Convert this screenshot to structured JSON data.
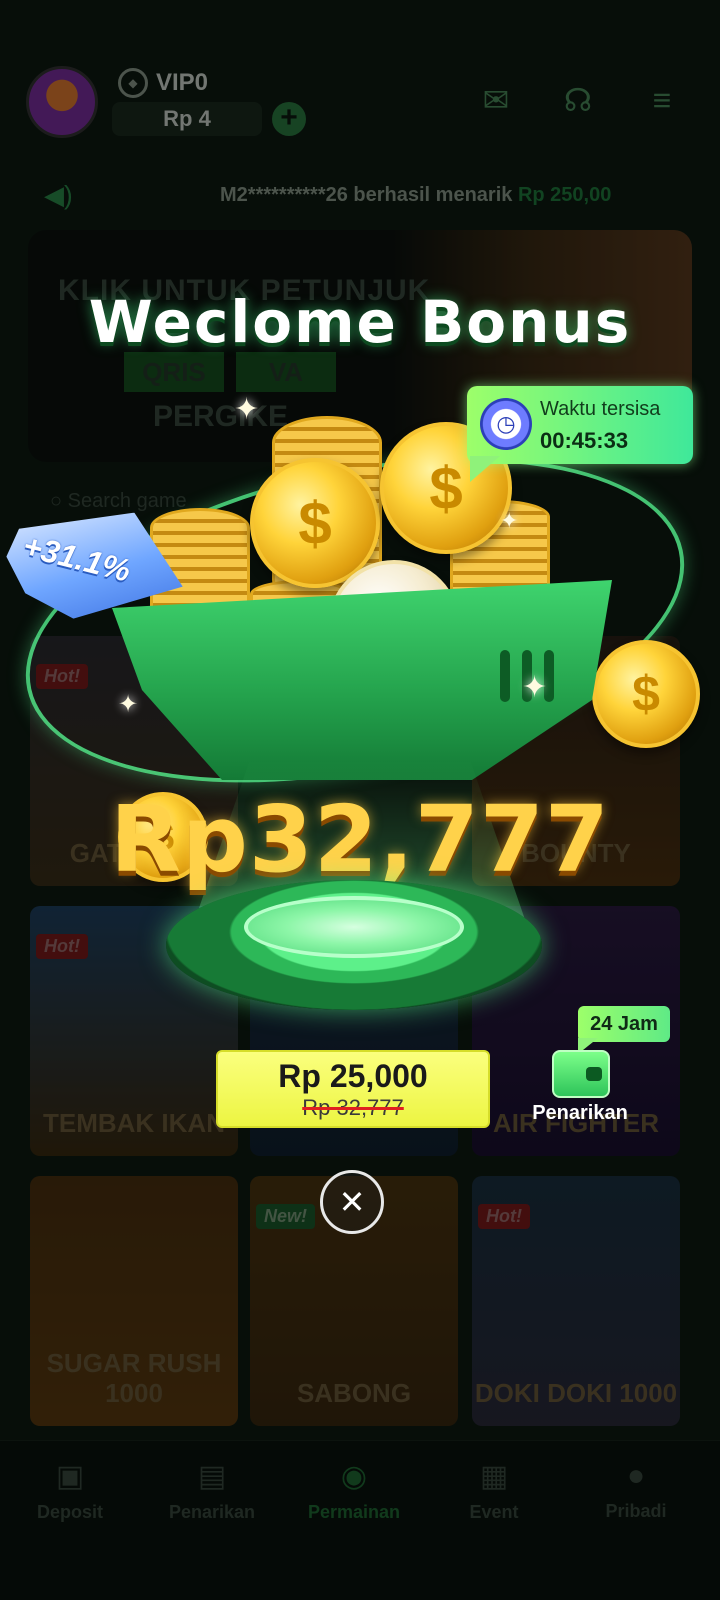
{
  "header": {
    "vip_label": "VIP0",
    "balance": "Rp 4",
    "icons": [
      "mail-icon",
      "headset-icon",
      "settings-sliders-icon"
    ]
  },
  "ticker": {
    "masked_user": "M2**********26 berhasil menarik",
    "amount": "Rp 250,00"
  },
  "banner": {
    "line1": "KLIK UNTUK PETUNJUK",
    "chip1": "QRIS",
    "chip2": "VA",
    "line3": "PERGIKE"
  },
  "search": {
    "placeholder": "Search game"
  },
  "games": [
    {
      "name": "GATE OLY",
      "badge": "Hot!"
    },
    {
      "name": "BOUNTY",
      "badge": ""
    },
    {
      "name": "TEMBAK IKAN",
      "badge": "Hot!"
    },
    {
      "name": "AIR FIGHTER",
      "badge": ""
    },
    {
      "name": "SUGAR RUSH 1000",
      "badge": ""
    },
    {
      "name": "SABONG",
      "badge": "New!"
    },
    {
      "name": "DOKI DOKI 1000",
      "badge": "Hot!"
    }
  ],
  "bottom_nav": [
    {
      "label": "Deposit",
      "icon": "wallet-icon"
    },
    {
      "label": "Penarikan",
      "icon": "withdraw-icon"
    },
    {
      "label": "Permainan",
      "icon": "gamepad-icon",
      "active": true
    },
    {
      "label": "Event",
      "icon": "gift-icon"
    },
    {
      "label": "Pribadi",
      "icon": "user-icon"
    }
  ],
  "modal": {
    "title": "Weclome Bonus",
    "bonus_percent": "+31.1%",
    "timer_label": "Waktu tersisa",
    "timer_value": "00:45:33",
    "amount": "Rp32,777",
    "price_now": "Rp 25,000",
    "price_old": "Rp 32,777",
    "tag": "24 Jam",
    "withdraw_label": "Penarikan",
    "close_symbol": "✕"
  },
  "colors": {
    "accent_green": "#3fd46e",
    "gold": "#ffd24a",
    "price_yellow": "#fbff7e",
    "ribbon_blue": "#6fa6ff"
  }
}
